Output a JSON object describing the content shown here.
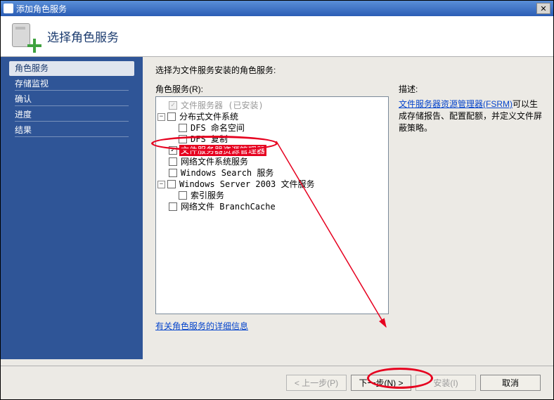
{
  "window": {
    "title": "添加角色服务"
  },
  "header": {
    "title": "选择角色服务"
  },
  "sidebar": {
    "items": [
      {
        "label": "角色服务",
        "active": true
      },
      {
        "label": "存储监视",
        "active": false
      },
      {
        "label": "确认",
        "active": false
      },
      {
        "label": "进度",
        "active": false
      },
      {
        "label": "结果",
        "active": false
      }
    ]
  },
  "content": {
    "instruction": "选择为文件服务安装的角色服务:",
    "tree_label": "角色服务(R):",
    "more_link": "有关角色服务的详细信息"
  },
  "tree": {
    "n0": "文件服务器  (已安装)",
    "n1": "分布式文件系统",
    "n1a": "DFS 命名空间",
    "n1b": "DFS 复制",
    "n2": "文件服务器资源管理器",
    "n3": "网络文件系统服务",
    "n4": "Windows Search 服务",
    "n5": "Windows Server 2003 文件服务",
    "n5a": "索引服务",
    "n6": "网络文件 BranchCache"
  },
  "description": {
    "title": "描述:",
    "link": "文件服务器资源管理器(FSRM)",
    "rest1": "可以生成存储报告、配置配额，并定义文件屏蔽策略。"
  },
  "footer": {
    "prev": "< 上一步(P)",
    "next": "下一步(N) >",
    "install": "安装(I)",
    "cancel": "取消"
  }
}
